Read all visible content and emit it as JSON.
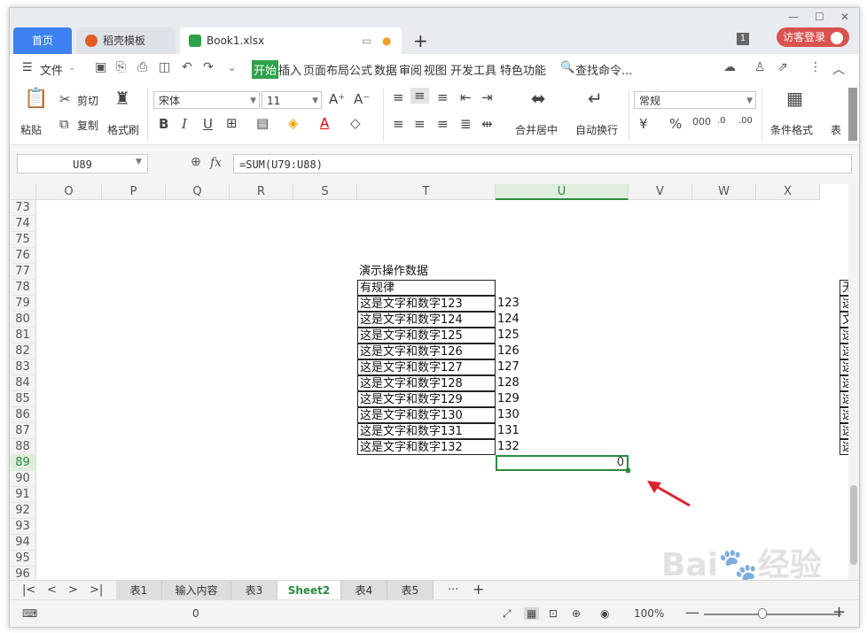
{
  "tabs": {
    "home": "首页",
    "template": "稻壳模板",
    "book": "Book1.xlsx",
    "guest": "访客登录",
    "badge": "1"
  },
  "menu": {
    "file": "文件",
    "items": [
      "开始",
      "插入",
      "页面布局",
      "公式",
      "数据",
      "审阅",
      "视图",
      "开发工具",
      "特色功能"
    ],
    "search": "查找命令..."
  },
  "ribbon": {
    "paste": "粘贴",
    "cut": "剪切",
    "copy": "复制",
    "format_painter": "格式刷",
    "font_name": "宋体",
    "font_size": "11",
    "merge_center": "合并居中",
    "wrap_text": "自动换行",
    "number_format": "常规",
    "cond_format": "条件格式",
    "table_style": "表"
  },
  "formula_bar": {
    "name_box": "U89",
    "fx": "fx",
    "formula": "=SUM(U79:U88)"
  },
  "grid": {
    "columns": [
      "O",
      "P",
      "Q",
      "R",
      "S",
      "T",
      "U",
      "V",
      "W",
      "X"
    ],
    "selected_column": "U",
    "rows": [
      "73",
      "74",
      "75",
      "76",
      "77",
      "78",
      "79",
      "80",
      "81",
      "82",
      "83",
      "84",
      "85",
      "86",
      "87",
      "88",
      "89",
      "90",
      "91",
      "92",
      "93",
      "94",
      "95",
      "96"
    ],
    "selected_row": "89",
    "title_cell": "演示操作数据",
    "header_cell": "有规律",
    "text_cells": [
      "这是文字和数字123",
      "这是文字和数字124",
      "这是文字和数字125",
      "这是文字和数字126",
      "这是文字和数字127",
      "这是文字和数字128",
      "这是文字和数字129",
      "这是文字和数字130",
      "这是文字和数字131",
      "这是文字和数字132"
    ],
    "number_cells": [
      "123",
      "124",
      "125",
      "126",
      "127",
      "128",
      "129",
      "130",
      "131",
      "132"
    ],
    "result_value": "0",
    "right_edge_header": "无",
    "right_edge_cells": [
      "这",
      "文",
      "这",
      "这",
      "这",
      "这",
      "这",
      "这",
      "这",
      "这"
    ]
  },
  "sheets": {
    "tabs": [
      "表1",
      "输入内容",
      "表3",
      "Sheet2",
      "表4",
      "表5"
    ],
    "active": "Sheet2",
    "more": "···",
    "add": "+"
  },
  "status": {
    "value": "0",
    "zoom": "100%"
  },
  "colors": {
    "accent_green": "#2d8a3e",
    "home_tab_blue": "#3d82f0",
    "guest_red": "#d9534f",
    "arrow_red": "#d9262c"
  }
}
